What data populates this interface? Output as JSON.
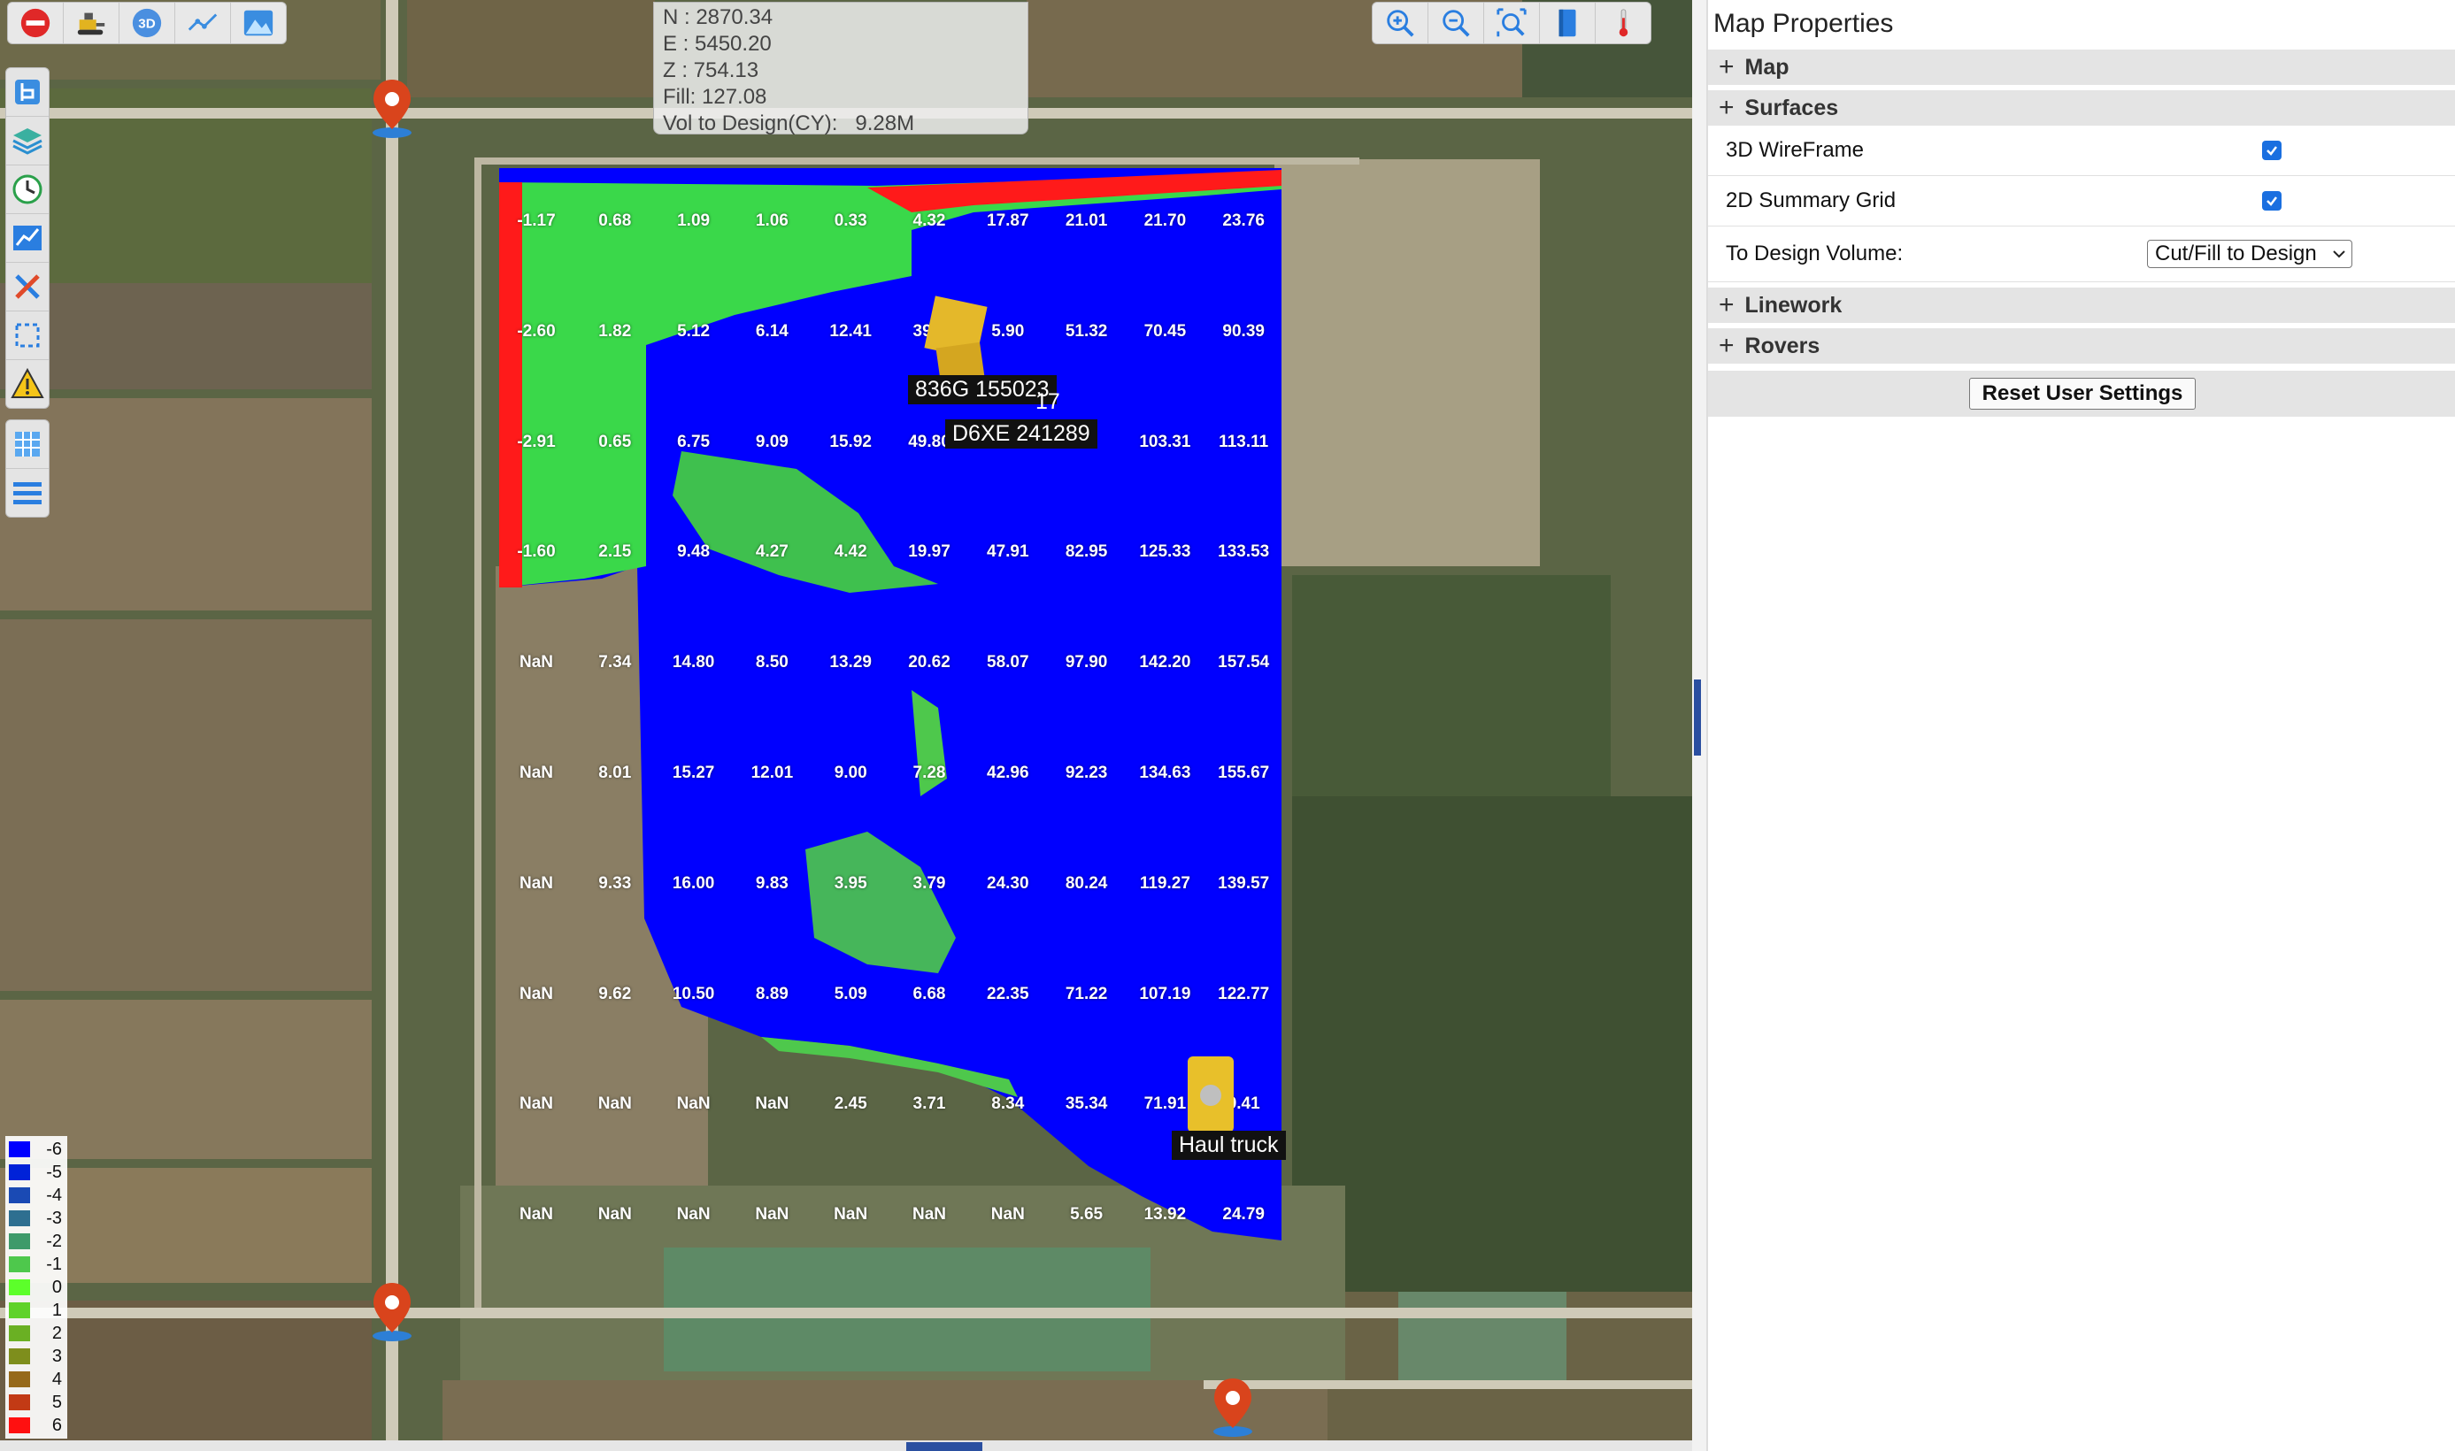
{
  "toolbar_top_left": {
    "buttons": [
      {
        "name": "stop-button",
        "icon": "stop-icon"
      },
      {
        "name": "machines-button",
        "icon": "machine-icon"
      },
      {
        "name": "3d-view-button",
        "icon": "3d-icon",
        "label": "3D"
      },
      {
        "name": "measure-button",
        "icon": "measure-icon"
      },
      {
        "name": "terrain-button",
        "icon": "terrain-icon"
      }
    ]
  },
  "toolbar_top_right": {
    "buttons": [
      {
        "name": "zoom-in-button",
        "icon": "zoom-in-icon"
      },
      {
        "name": "zoom-out-button",
        "icon": "zoom-out-icon"
      },
      {
        "name": "zoom-extents-button",
        "icon": "zoom-extents-icon"
      },
      {
        "name": "book-button",
        "icon": "book-icon"
      },
      {
        "name": "temperature-button",
        "icon": "thermometer-icon"
      }
    ]
  },
  "toolbar_left": {
    "buttons": [
      "design-icon",
      "layers-icon",
      "history-clock-icon",
      "chart-icon",
      "tools-icon",
      "boundary-icon",
      "warning-icon",
      "grid-icon",
      "list-icon"
    ]
  },
  "coordinates": {
    "north": "N : 2870.34",
    "east": "E : 5450.20",
    "z": "Z : 754.13",
    "fill": "Fill: 127.08",
    "vol": "Vol to Design(CY):   9.28M"
  },
  "grid_values": [
    [
      "-1.17",
      "0.68",
      "1.09",
      "1.06",
      "0.33",
      "4.32",
      "17.87",
      "21.01",
      "21.70",
      "23.76"
    ],
    [
      "-2.60",
      "1.82",
      "5.12",
      "6.14",
      "12.41",
      "39.4",
      "5.90",
      "51.32",
      "70.45",
      "90.39"
    ],
    [
      "-2.91",
      "0.65",
      "6.75",
      "9.09",
      "15.92",
      "49.80",
      "",
      "4",
      "103.31",
      "113.11"
    ],
    [
      "-1.60",
      "2.15",
      "9.48",
      "4.27",
      "4.42",
      "19.97",
      "47.91",
      "82.95",
      "125.33",
      "133.53"
    ],
    [
      "NaN",
      "7.34",
      "14.80",
      "8.50",
      "13.29",
      "20.62",
      "58.07",
      "97.90",
      "142.20",
      "157.54"
    ],
    [
      "NaN",
      "8.01",
      "15.27",
      "12.01",
      "9.00",
      "7.28",
      "42.96",
      "92.23",
      "134.63",
      "155.67"
    ],
    [
      "NaN",
      "9.33",
      "16.00",
      "9.83",
      "3.95",
      "3.79",
      "24.30",
      "80.24",
      "119.27",
      "139.57"
    ],
    [
      "NaN",
      "9.62",
      "10.50",
      "8.89",
      "5.09",
      "6.68",
      "22.35",
      "71.22",
      "107.19",
      "122.77"
    ],
    [
      "NaN",
      "NaN",
      "NaN",
      "NaN",
      "2.45",
      "3.71",
      "8.34",
      "35.34",
      "71.91",
      "9.41"
    ],
    [
      "NaN",
      "NaN",
      "NaN",
      "NaN",
      "NaN",
      "NaN",
      "NaN",
      "5.65",
      "13.92",
      "24.79"
    ]
  ],
  "machines": {
    "label_1": "836G 155023",
    "label_1b": "17",
    "label_2": "D6XE 241289",
    "label_3": "Haul truck"
  },
  "legend": {
    "entries": [
      {
        "label": "-6",
        "color": "#0000ff"
      },
      {
        "label": "-5",
        "color": "#0022d8"
      },
      {
        "label": "-4",
        "color": "#1a4ab4"
      },
      {
        "label": "-3",
        "color": "#2e6f90"
      },
      {
        "label": "-2",
        "color": "#3e9a6a"
      },
      {
        "label": "-1",
        "color": "#4ec84c"
      },
      {
        "label": "0",
        "color": "#5cff2a"
      },
      {
        "label": "1",
        "color": "#5fd22a"
      },
      {
        "label": "2",
        "color": "#6ab023"
      },
      {
        "label": "3",
        "color": "#7e8e1c"
      },
      {
        "label": "4",
        "color": "#96691a"
      },
      {
        "label": "5",
        "color": "#c23a15"
      },
      {
        "label": "6",
        "color": "#ff1010"
      }
    ]
  },
  "panel": {
    "title": "Map Properties",
    "sections": {
      "map": "Map",
      "surfaces": "Surfaces",
      "linework": "Linework",
      "rovers": "Rovers"
    },
    "wireframe_label": "3D WireFrame",
    "wireframe_checked": true,
    "summary_label": "2D Summary Grid",
    "summary_checked": true,
    "design_volume_label": "To Design Volume:",
    "design_volume_value": "Cut/Fill to Design",
    "reset_label": "Reset User Settings"
  },
  "colors": {
    "accent": "#1a6fe0",
    "cut_fill_blue": "#0000ff",
    "cut_fill_green": "#5cff2a",
    "cut_fill_red": "#ff1010"
  }
}
